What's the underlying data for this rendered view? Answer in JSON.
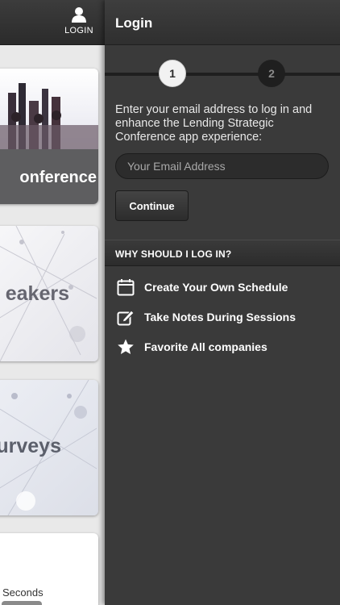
{
  "left": {
    "login_tab_label": "LOGIN",
    "cards": [
      {
        "title": "onference"
      },
      {
        "title": "eakers"
      },
      {
        "title": "urveys"
      },
      {
        "caption": "Seconds"
      }
    ]
  },
  "panel": {
    "title": "Login",
    "steps": [
      "1",
      "2"
    ],
    "intro": "Enter your email address to log in and enhance the Lending Strategic Conference app experience:",
    "email_placeholder": "Your Email Address",
    "continue_label": "Continue",
    "why_heading": "WHY SHOULD I LOG IN?",
    "features": [
      {
        "icon": "calendar-icon",
        "label": "Create Your Own Schedule"
      },
      {
        "icon": "edit-note-icon",
        "label": "Take Notes During Sessions"
      },
      {
        "icon": "star-icon",
        "label": "Favorite All companies"
      }
    ]
  }
}
